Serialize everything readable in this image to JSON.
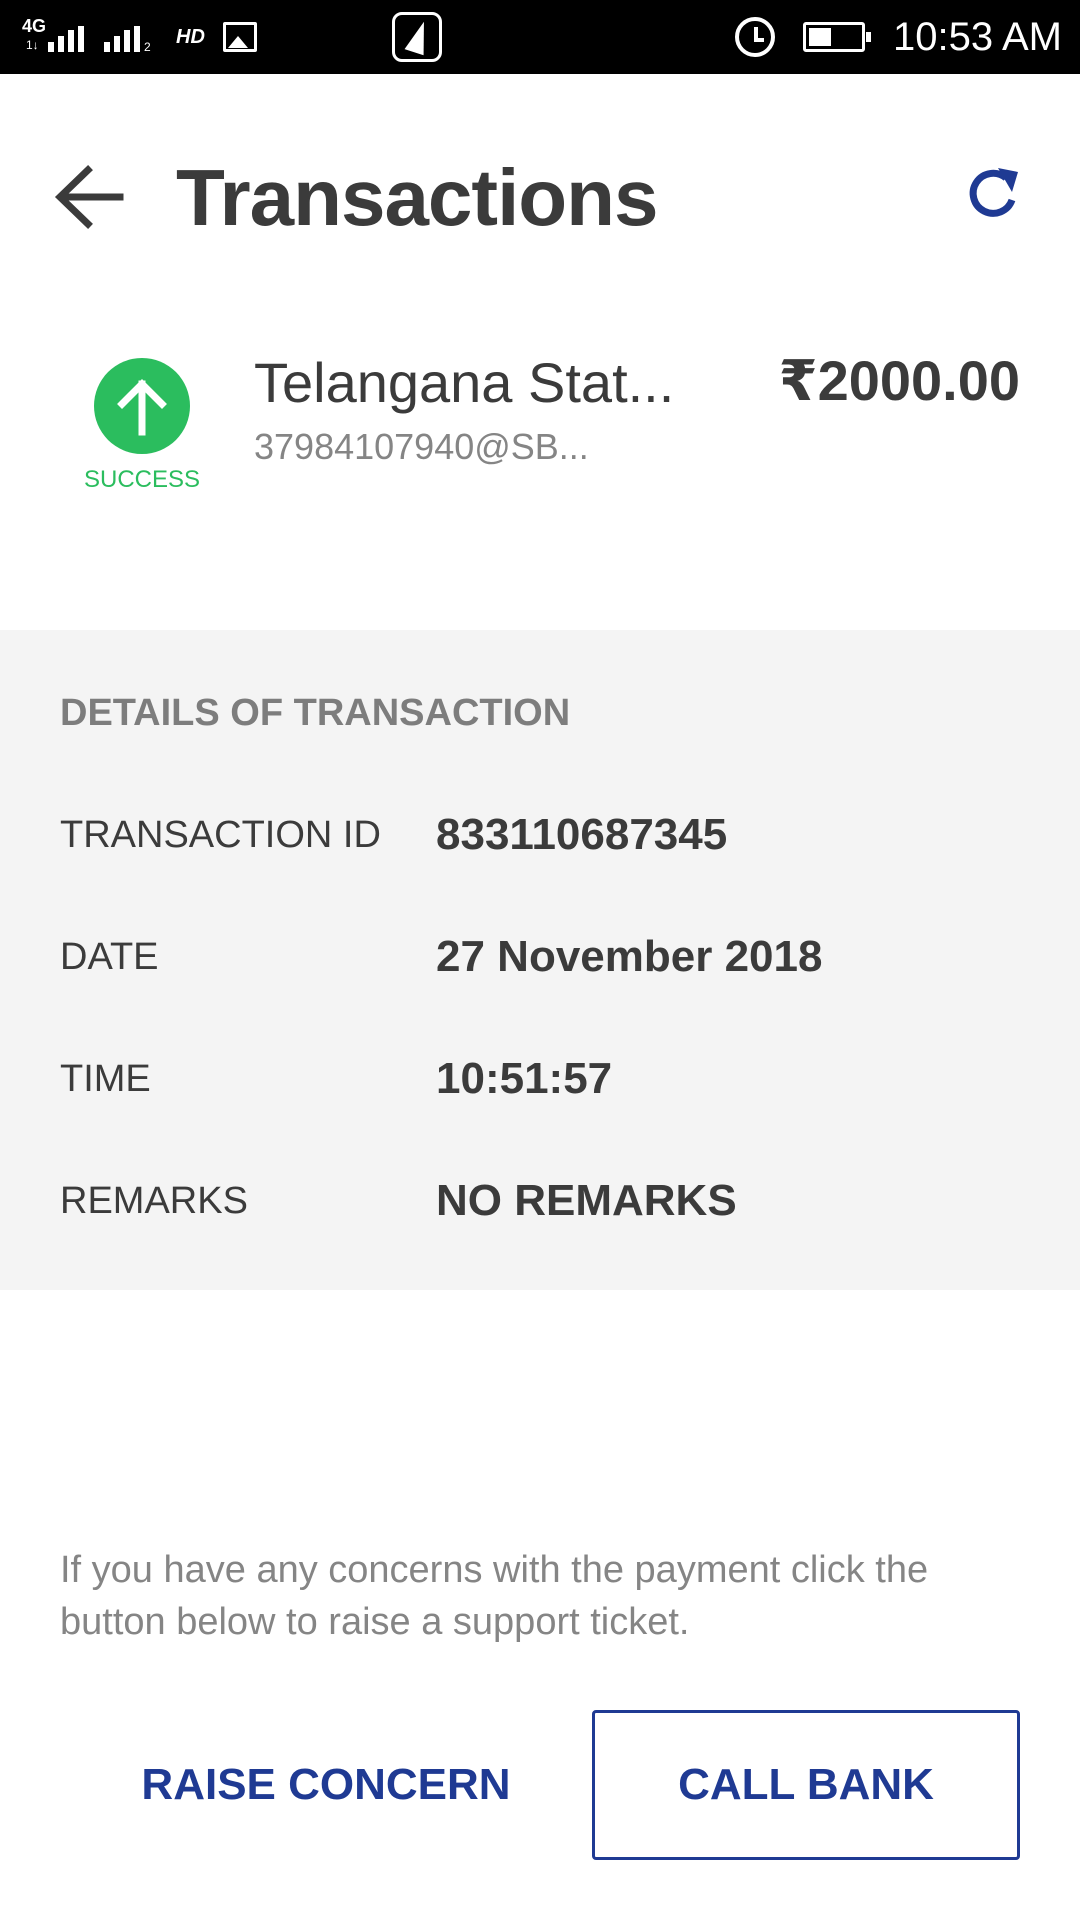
{
  "status_bar": {
    "network_type": "4G",
    "network_sub": "1↓",
    "sim1_index": "1",
    "sim2_index": "2",
    "hd_label": "HD",
    "battery_level": 0.45,
    "time": "10:53 AM"
  },
  "header": {
    "title": "Transactions",
    "back_icon": "arrow-left-icon",
    "refresh_icon": "refresh-icon"
  },
  "transaction": {
    "status": "SUCCESS",
    "status_icon": "arrow-up-icon",
    "status_color": "#2bbd5e",
    "payee_name": "Telangana Stat...",
    "payee_vpa": "37984107940@SB...",
    "amount": "₹2000.00"
  },
  "details": {
    "heading": "DETAILS OF TRANSACTION",
    "rows": [
      {
        "label": "TRANSACTION ID",
        "value": "833110687345"
      },
      {
        "label": "DATE",
        "value": "27 November 2018"
      },
      {
        "label": "TIME",
        "value": "10:51:57"
      },
      {
        "label": "REMARKS",
        "value": "NO REMARKS"
      }
    ]
  },
  "support": {
    "message": "If you have any concerns with the payment click the button below to raise a support ticket.",
    "raise_label": "RAISE CONCERN",
    "call_label": "CALL BANK"
  },
  "colors": {
    "accent": "#1f3a93",
    "success": "#2bbd5e",
    "details_background": "#f4f4f4"
  }
}
